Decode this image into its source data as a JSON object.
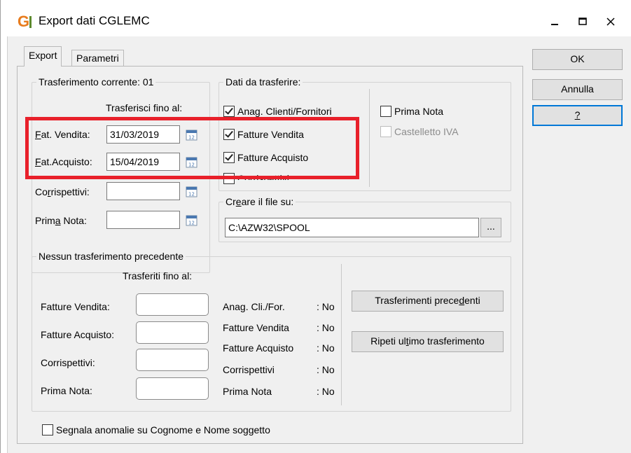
{
  "window": {
    "title": "Export dati CGLEMC",
    "app_icon_letter": "G",
    "controls": {
      "minimize": "_",
      "maximize": "☐",
      "close": "✕"
    }
  },
  "tabs": [
    {
      "label": "Export",
      "active": true
    },
    {
      "label": "Parametri",
      "active": false
    }
  ],
  "buttons": {
    "ok": "OK",
    "annulla": "Annulla",
    "help": "?"
  },
  "trasferimento": {
    "group_title": "Trasferimento corrente: 01",
    "header": "Trasferisci fino al:",
    "fields": [
      {
        "label_pre": "",
        "label_ul": "F",
        "label_post": "at. Vendita:",
        "value": "31/03/2019"
      },
      {
        "label_pre": "",
        "label_ul": "F",
        "label_post": "at.Acquisto:",
        "value": "15/04/2019"
      },
      {
        "label_pre": "Co",
        "label_ul": "r",
        "label_post": "rispettivi:",
        "value": ""
      },
      {
        "label_pre": "Prim",
        "label_ul": "a",
        "label_post": " Nota:",
        "value": ""
      }
    ]
  },
  "dati": {
    "group_title": "Dati da trasferire:",
    "checkboxes": [
      {
        "label": "Anag. Clienti/Fornitori",
        "checked": true,
        "disabled": false
      },
      {
        "label": "Fatture Vendita",
        "checked": true,
        "disabled": false
      },
      {
        "label": "Fatture Acquisto",
        "checked": true,
        "disabled": false
      },
      {
        "label": "Corrispettivi",
        "checked": false,
        "disabled": false
      },
      {
        "label": "Prima Nota",
        "checked": false,
        "disabled": false
      },
      {
        "label": "Castelletto IVA",
        "checked": false,
        "disabled": true
      }
    ]
  },
  "file": {
    "group_title_pre": "Cr",
    "group_title_ul": "e",
    "group_title_post": "are il file su:",
    "path": "C:\\AZW32\\SPOOL",
    "browse_label": "..."
  },
  "precedente": {
    "group_title": "Nessun trasferimento precedente",
    "header": "Trasferiti fino al:",
    "fields": [
      {
        "label": "Fatture Vendita:",
        "value": ""
      },
      {
        "label": "Fatture Acquisto:",
        "value": ""
      },
      {
        "label": "Corrispettivi:",
        "value": ""
      },
      {
        "label": "Prima Nota:",
        "value": ""
      }
    ],
    "status": [
      {
        "label": "Anag. Cli./For.",
        "value": ": No"
      },
      {
        "label": "Fatture Vendita",
        "value": ": No"
      },
      {
        "label": "Fatture Acquisto",
        "value": ": No"
      },
      {
        "label": "Corrispettivi",
        "value": ": No"
      },
      {
        "label": "Prima Nota",
        "value": ": No"
      }
    ],
    "btn_precedenti_pre": "Trasferimenti prece",
    "btn_precedenti_ul": "d",
    "btn_precedenti_post": "enti",
    "btn_ripeti_pre": "Ripeti ul",
    "btn_ripeti_ul": "t",
    "btn_ripeti_post": "imo trasferimento"
  },
  "segnala": {
    "label": "Segnala anomalie su Cognome e Nome soggetto",
    "checked": false
  },
  "colors": {
    "highlight": "#e8202a",
    "default_button_border": "#0078d7"
  }
}
